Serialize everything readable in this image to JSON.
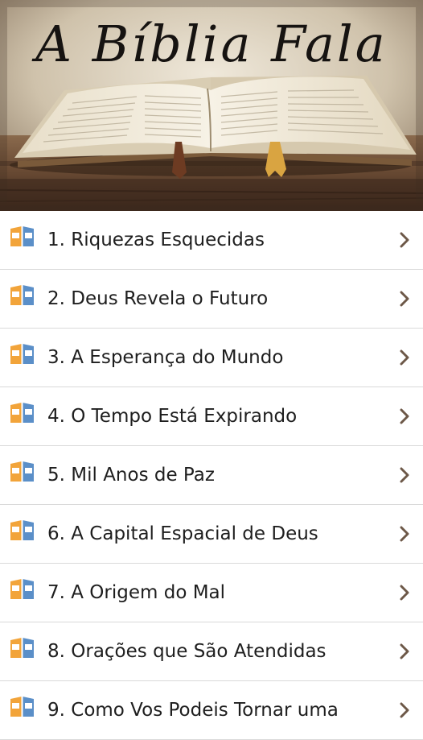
{
  "header": {
    "title": "A Bíblia Fala",
    "image": "open-bible-on-wooden-table",
    "colors": {
      "sky": "#d7ccb8",
      "wood": "#6b4a32",
      "pages": "#f2ecde",
      "ribbon_gold": "#d9a441",
      "ribbon_brown": "#6d3b22"
    }
  },
  "chapters": [
    {
      "label": "1. Riquezas Esquecidas"
    },
    {
      "label": "2. Deus Revela o Futuro"
    },
    {
      "label": "3. A Esperança do Mundo"
    },
    {
      "label": "4. O Tempo Está Expirando"
    },
    {
      "label": "5. Mil Anos de Paz"
    },
    {
      "label": "6. A Capital Espacial de Deus"
    },
    {
      "label": "7. A Origem do Mal"
    },
    {
      "label": "8. Orações que São Atendidas"
    },
    {
      "label": "9. Como Vos Podeis Tornar uma"
    }
  ],
  "icons": {
    "item": "open-book-icon",
    "arrow": "chevron-right-icon"
  },
  "colors": {
    "icon_orange": "#f2a43a",
    "icon_blue": "#5b8fc8",
    "chevron": "#6d5848",
    "divider": "#d9d9d9",
    "text": "#1e1e1e"
  }
}
